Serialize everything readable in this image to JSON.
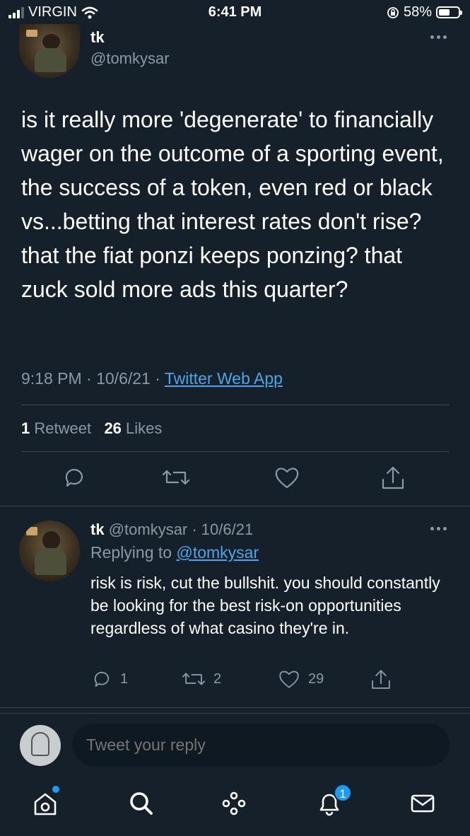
{
  "status_bar": {
    "carrier": "VIRGIN",
    "time": "6:41 PM",
    "battery": "58%",
    "battery_level": 0.58,
    "icons": [
      "signal-icon",
      "wifi-icon",
      "orientation-lock-icon",
      "battery-icon"
    ]
  },
  "main_tweet": {
    "name": "tk",
    "handle": "@tomkysar",
    "text": "is it really more 'degenerate' to financially wager on the outcome of a sporting event, the success of a token, even red or black vs...betting that interest rates don't rise? that the fiat ponzi keeps ponzing? that zuck sold more ads this quarter?",
    "time": "9:18 PM · 10/6/21 · ",
    "source": "Twitter Web App",
    "retweets_count": "1",
    "retweets_label": "Retweet",
    "likes_count": "26",
    "likes_label": "Likes"
  },
  "reply_tweet": {
    "name": "tk",
    "handle_date": "@tomkysar · 10/6/21",
    "replying_prefix": "Replying to ",
    "replying_to": "@tomkysar",
    "text": "risk is risk, cut the bullshit. you should constantly be looking for the best risk-on opportunities regardless of what casino they're in.",
    "reply_count": "1",
    "retweet_count": "2",
    "like_count": "29"
  },
  "compose": {
    "placeholder": "Tweet your reply"
  },
  "tabbar": {
    "notifications_badge": "1",
    "items": [
      "home-icon",
      "search-icon",
      "spaces-icon",
      "notifications-icon",
      "messages-icon"
    ]
  },
  "colors": {
    "background": "#15202b",
    "accent": "#1d9bf0",
    "secondary_text": "#8b98a5",
    "divider": "#38444d"
  }
}
